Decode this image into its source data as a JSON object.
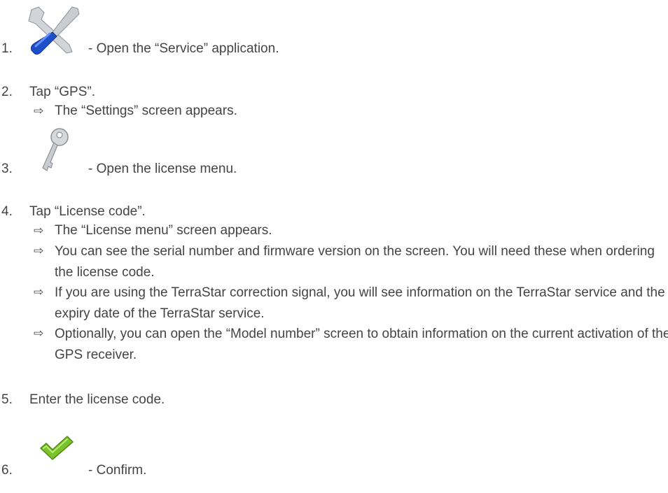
{
  "steps": [
    {
      "num": "1.",
      "text": "- Open the “Service” application.",
      "icon": "service-tools-icon"
    },
    {
      "num": "2.",
      "text": "Tap “GPS”."
    },
    {
      "num": "3.",
      "text": "- Open the license menu.",
      "icon": "key-icon"
    },
    {
      "num": "4.",
      "text": "Tap “License code”."
    },
    {
      "num": "5.",
      "text": "Enter the license code."
    },
    {
      "num": "6.",
      "text": "- Confirm.",
      "icon": "checkmark-icon"
    }
  ],
  "results": {
    "step2": [
      "The “Settings” screen appears."
    ],
    "step4": [
      "The “License menu” screen appears.",
      "You can see the serial number and firmware version on the screen. You will need these when ordering the license code.",
      "If you are using the TerraStar correction signal, you will see information on the TerraStar service and the expiry date of the TerraStar service.",
      "Optionally, you can open the “Model number” screen to obtain information on the current activation of the GPS receiver."
    ]
  },
  "arrow_glyph": "⇨",
  "colors": {
    "text": "#444444",
    "wrench_handle": "#1e4fc8",
    "tool_metal": "#c9ccd0",
    "check_green": "#7cc22a"
  }
}
